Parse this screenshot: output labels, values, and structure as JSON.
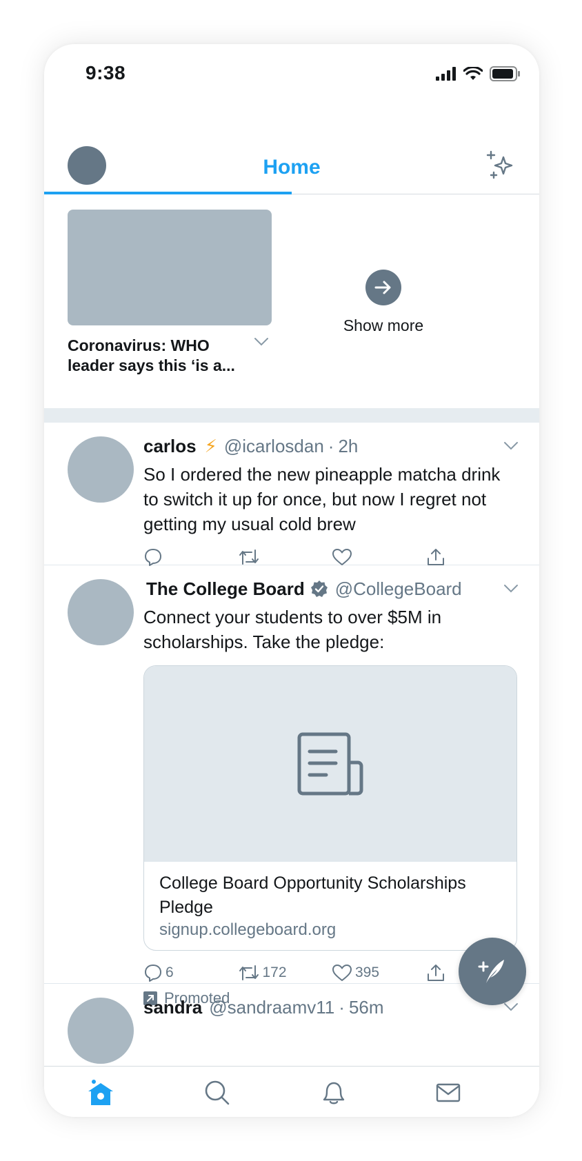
{
  "status_bar": {
    "time": "9:38"
  },
  "header": {
    "title": "Home"
  },
  "carousel": {
    "news_title": "Coronavirus: WHO leader says this ‘is a...",
    "show_more_label": "Show more"
  },
  "tweets": [
    {
      "name": "carlos",
      "name_emoji": "⚡",
      "handle": "@icarlosdan",
      "dot": "·",
      "time": "2h",
      "text": "So I ordered the new pineapple matcha drink to switch it up for once, but now I regret not getting my usual cold brew"
    },
    {
      "name": "The College Board",
      "handle": "@CollegeBoard",
      "text": "Connect your students to over $5M in scholarships. Take the pledge:",
      "card": {
        "title": "College Board Opportunity Scholarships Pledge",
        "url": "signup.collegeboard.org"
      },
      "replies": "6",
      "retweets": "172",
      "likes": "395",
      "promoted_label": "Promoted"
    },
    {
      "name": "sandra",
      "handle": "@sandraamv11",
      "dot": "·",
      "time": "56m"
    }
  ],
  "colors": {
    "accent": "#1da1f2",
    "placeholder": "#aab8c2",
    "icon": "#657786",
    "band": "#e6ecf0"
  },
  "icons": [
    "signal-icon",
    "wifi-icon",
    "battery-icon",
    "sparkle-icon",
    "arrow-right-icon",
    "chevron-down-icon",
    "reply-icon",
    "retweet-icon",
    "like-icon",
    "share-icon",
    "verified-icon",
    "document-icon",
    "promoted-icon",
    "compose-icon",
    "home-icon",
    "search-icon",
    "bell-icon",
    "mail-icon"
  ]
}
